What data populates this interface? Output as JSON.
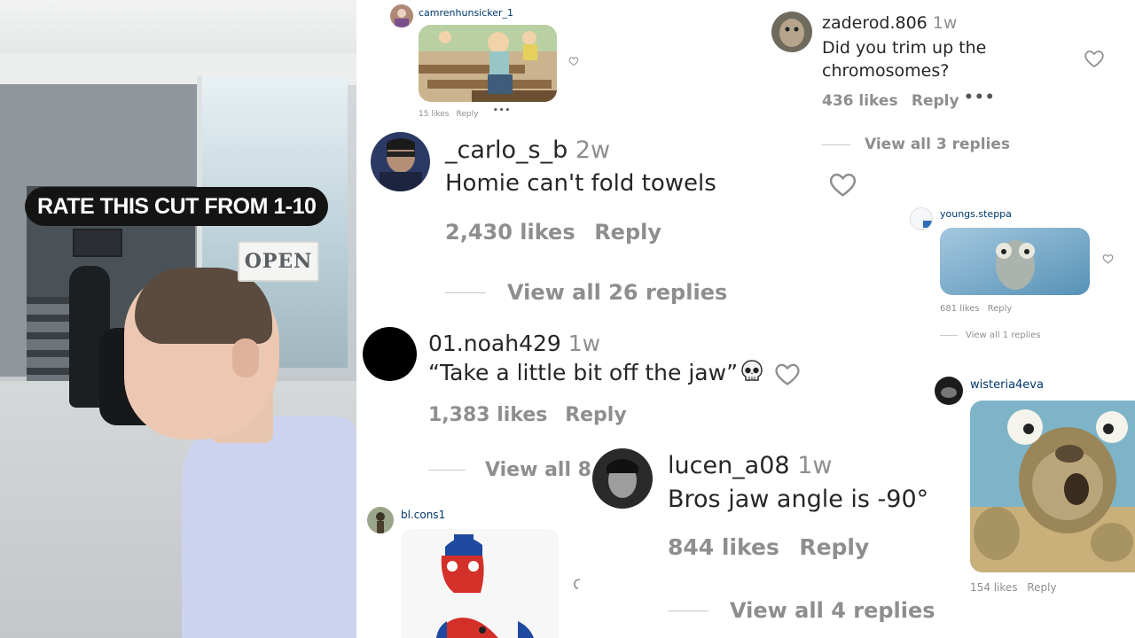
{
  "video": {
    "overlay_text": "RATE THIS CUT FROM 1-10",
    "sign_text": "OPEN"
  },
  "comments": [
    {
      "id": "camrenhunsicker",
      "username": "camrenhunsicker_1",
      "likes": "15 likes",
      "reply": "Reply",
      "more": "•••",
      "media": "cartoon-gif"
    },
    {
      "id": "carlo",
      "username": "_carlo_s_b",
      "time": "2w",
      "text": "Homie can't fold towels",
      "likes": "2,430 likes",
      "reply": "Reply",
      "view_all": "View all 26 replies"
    },
    {
      "id": "noah",
      "username": "01.noah429",
      "time": "1w",
      "text": "“Take a little bit off the jaw”",
      "emoji": "skull",
      "likes": "1,383 likes",
      "reply": "Reply",
      "view_all": "View all 8"
    },
    {
      "id": "blcons",
      "username": "bl.cons1",
      "media": "spiderman-meme"
    },
    {
      "id": "zaderod",
      "username": "zaderod.806",
      "time": "1w",
      "text_lines": [
        "Did you trim up the",
        "chromosomes?"
      ],
      "likes": "436 likes",
      "reply": "Reply",
      "more": "•••",
      "view_all": "View all 3 replies"
    },
    {
      "id": "youngs",
      "username": "youngs.steppa",
      "likes": "681 likes",
      "reply": "Reply",
      "view_all": "View all 1 replies",
      "media": "sid-ice-gif"
    },
    {
      "id": "lucen",
      "username": "lucen_a08",
      "time": "1w",
      "text": "Bros jaw angle is -90°",
      "likes": "844 likes",
      "reply": "Reply",
      "view_all": "View all 4 replies"
    },
    {
      "id": "wisteria",
      "username": "wisteria4eva",
      "likes": "154 likes",
      "reply": "Reply",
      "media": "sid-gif"
    }
  ],
  "colors": {
    "text": "#262626",
    "muted": "#8e8e8e",
    "link_blue": "#00376b"
  }
}
